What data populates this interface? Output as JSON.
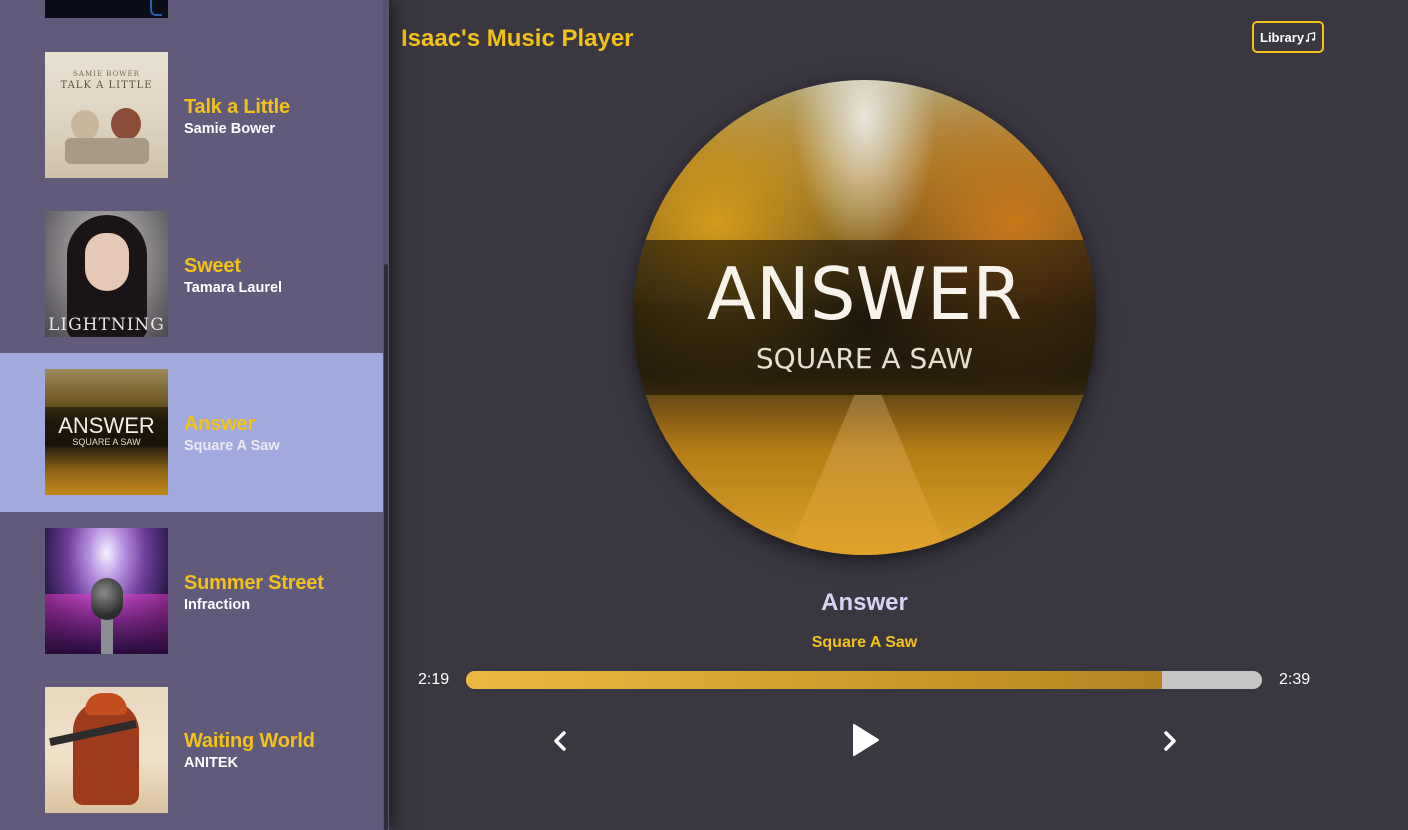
{
  "header": {
    "title": "Isaac's Music Player",
    "library_label": "Library"
  },
  "playlist": [
    {
      "name": "Talk a Little",
      "artist": "Samie Bower",
      "cover_text": [
        "SAMIE BOWER",
        "TALK A LITTLE"
      ],
      "active": false
    },
    {
      "name": "Sweet",
      "artist": "Tamara Laurel",
      "cover_text": [
        "LIGHTNING"
      ],
      "active": false
    },
    {
      "name": "Answer",
      "artist": "Square A Saw",
      "cover_text": [
        "ANSWER",
        "SQUARE A SAW"
      ],
      "active": true
    },
    {
      "name": "Summer Street",
      "artist": "Infraction",
      "cover_text": [],
      "active": false
    },
    {
      "name": "Waiting World",
      "artist": "ANITEK",
      "cover_text": [],
      "active": false
    }
  ],
  "now_playing": {
    "title": "Answer",
    "artist": "Square A Saw",
    "cover_text": [
      "ANSWER",
      "SQUARE A SAW"
    ],
    "current_time": "2:19",
    "total_time": "2:39",
    "progress_fraction": 0.874
  },
  "icons": {
    "library": "music-note-icon",
    "prev": "chevron-left-icon",
    "play": "play-icon",
    "next": "chevron-right-icon"
  },
  "colors": {
    "accent": "#f2c21b",
    "sidebar_bg": "#625a7b",
    "active_song_bg": "#a2a9dc",
    "main_bg": "#3a3741",
    "progress_start": "#ebb940",
    "progress_end": "#b2841f",
    "track_bg": "#c6c6c6"
  }
}
